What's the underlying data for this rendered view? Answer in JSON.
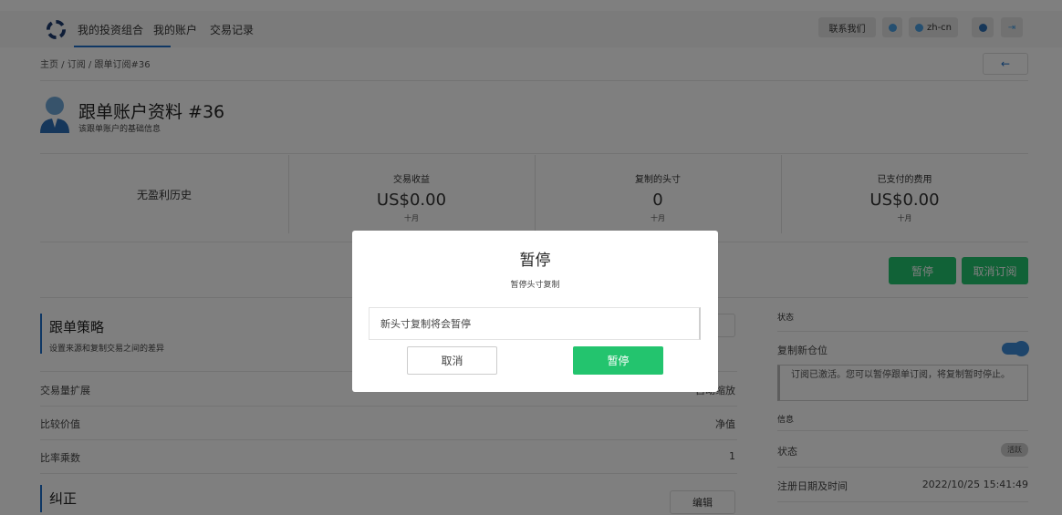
{
  "nav": {
    "items": [
      "我的投资组合",
      "我的账户",
      "交易记录"
    ],
    "contact_label": "联系我们",
    "lang_label": "zh-cn"
  },
  "breadcrumb": "主页 / 订阅 / 跟单订阅#36",
  "back_icon": "←",
  "profile": {
    "title": "跟单账户资料 #36",
    "subtitle": "该跟单账户的基础信息"
  },
  "stats": {
    "no_profit": "无盈利历史",
    "items": [
      {
        "label": "交易收益",
        "value": "US$0.00",
        "period": "十月"
      },
      {
        "label": "复制的头寸",
        "value": "0",
        "period": "十月"
      },
      {
        "label": "已支付的费用",
        "value": "US$0.00",
        "period": "十月"
      }
    ]
  },
  "actions": {
    "pause_label": "暂停",
    "unsubscribe_label": "取消订阅"
  },
  "strategy": {
    "title": "跟单策略",
    "subtitle": "设置来源和复制交易之间的差异",
    "rows": [
      {
        "label": "交易量扩展",
        "value": "自动缩放"
      },
      {
        "label": "比较价值",
        "value": "净值"
      },
      {
        "label": "比率乘数",
        "value": "1"
      }
    ]
  },
  "correction": {
    "title": "纠正",
    "edit_label": "编辑"
  },
  "right_panel": {
    "status_heading": "状态",
    "copy_new_label": "复制新仓位",
    "copy_new_on": true,
    "notice": "订阅已激活。您可以暂停跟单订阅，将复制暂时停止。",
    "info_heading": "信息",
    "status_label": "状态",
    "status_badge": "活跃",
    "reg_label": "注册日期及时间",
    "reg_value": "2022/10/25 15:41:49"
  },
  "modal": {
    "title": "暂停",
    "subtitle": "暂停头寸复制",
    "message": "新头寸复制将会暂停",
    "cancel_label": "取消",
    "confirm_label": "暂停"
  },
  "colors": {
    "accent": "#1f6fc9",
    "green": "#23c46e",
    "overlay": "rgba(0,0,0,0.5)"
  }
}
